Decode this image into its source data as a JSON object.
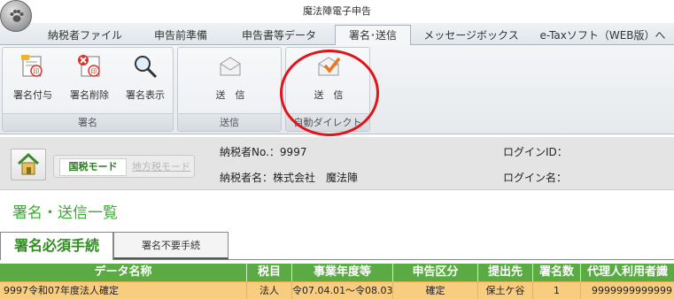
{
  "window": {
    "title": "魔法陣電子申告"
  },
  "tabs": [
    {
      "label": "納税者ファイル"
    },
    {
      "label": "申告前準備"
    },
    {
      "label": "申告書等データ"
    },
    {
      "label": "署名･送信",
      "active": true
    },
    {
      "label": "メッセージボックス"
    },
    {
      "label": "e-Taxソフト（WEB版）へ"
    }
  ],
  "ribbon": {
    "groups": [
      {
        "label": "署名",
        "buttons": [
          {
            "label": "署名付与",
            "icon": "sign-add-icon"
          },
          {
            "label": "署名削除",
            "icon": "sign-delete-icon"
          },
          {
            "label": "署名表示",
            "icon": "magnifier-icon"
          }
        ]
      },
      {
        "label": "送信",
        "buttons": [
          {
            "label": "送　信",
            "icon": "envelope-icon"
          }
        ]
      },
      {
        "label": "自動ダイレクト",
        "buttons": [
          {
            "label": "送　信",
            "icon": "envelope-check-icon"
          }
        ]
      }
    ]
  },
  "info": {
    "mode_kokuzei": "国税モード",
    "mode_chiho": "地方税モード",
    "taxpayer_no": "納税者No.：9997",
    "taxpayer_name": "納税者名：株式会社　魔法陣",
    "login_id": "ログインID：",
    "login_name": "ログイン名："
  },
  "page_title": "署名・送信一覧",
  "subtabs": {
    "active": "署名必須手続",
    "other": "署名不要手続"
  },
  "table": {
    "headers": [
      "データ名称",
      "税目",
      "事業年度等",
      "申告区分",
      "提出先",
      "署名数",
      "代理人利用者識"
    ],
    "rows": [
      [
        "9997令和07年度法人確定",
        "法人",
        "令07.04.01～令08.03.31",
        "確定",
        "保土ケ谷",
        "1",
        "9999999999999"
      ]
    ]
  },
  "colors": {
    "accent_green": "#3aa832",
    "header_green": "#5aab43",
    "row_highlight": "#f9cd7f",
    "annotation_red": "#e0141a"
  }
}
